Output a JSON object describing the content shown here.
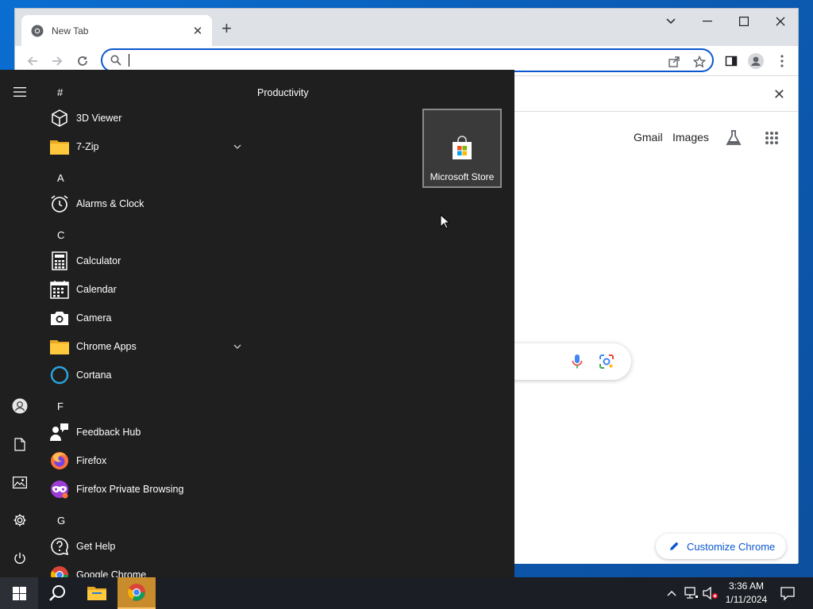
{
  "browser": {
    "tab_title": "New Tab",
    "omnibox_value": "",
    "toplinks": {
      "gmail": "Gmail",
      "images": "Images"
    },
    "customize_label": "Customize Chrome"
  },
  "start_menu": {
    "group_title": "Productivity",
    "tile_label": "Microsoft Store",
    "sections": [
      {
        "letter": "#",
        "apps": [
          {
            "label": "3D Viewer",
            "icon": "3d-viewer-icon"
          },
          {
            "label": "7-Zip",
            "icon": "folder-icon",
            "expandable": true
          }
        ]
      },
      {
        "letter": "A",
        "apps": [
          {
            "label": "Alarms & Clock",
            "icon": "alarm-clock-icon"
          }
        ]
      },
      {
        "letter": "C",
        "apps": [
          {
            "label": "Calculator",
            "icon": "calculator-icon"
          },
          {
            "label": "Calendar",
            "icon": "calendar-icon"
          },
          {
            "label": "Camera",
            "icon": "camera-icon"
          },
          {
            "label": "Chrome Apps",
            "icon": "folder-icon",
            "expandable": true
          },
          {
            "label": "Cortana",
            "icon": "cortana-icon"
          }
        ]
      },
      {
        "letter": "F",
        "apps": [
          {
            "label": "Feedback Hub",
            "icon": "feedback-hub-icon"
          },
          {
            "label": "Firefox",
            "icon": "firefox-icon"
          },
          {
            "label": "Firefox Private Browsing",
            "icon": "firefox-private-icon"
          }
        ]
      },
      {
        "letter": "G",
        "apps": [
          {
            "label": "Get Help",
            "icon": "get-help-icon"
          },
          {
            "label": "Google Chrome",
            "icon": "chrome-icon"
          }
        ]
      }
    ]
  },
  "taskbar": {
    "time": "3:36 AM",
    "date": "1/11/2024"
  },
  "colors": {
    "accent": "#0b57d0",
    "start_bg": "#1f1f1f",
    "taskbar_bg": "#1b1e24",
    "chrome_taskbar_highlight": "#c98c2c"
  }
}
